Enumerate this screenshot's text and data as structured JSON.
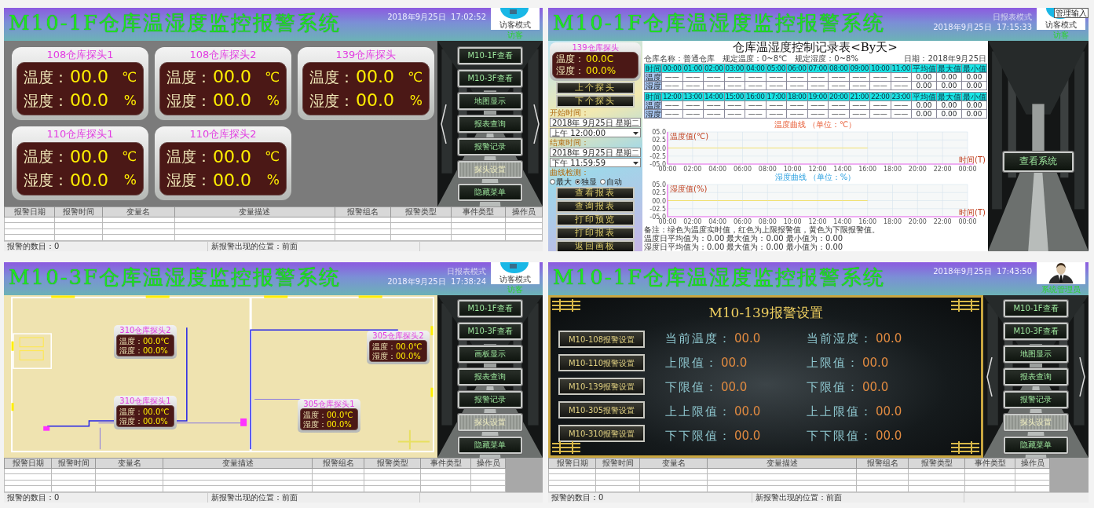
{
  "panels": [
    {
      "kind": "overview",
      "header": {
        "title": "M10-1F仓库温湿度监控报警系统",
        "datetime": "2018年9月25日  17:02:52",
        "user": {
          "kind": "logo",
          "badge": "访客模式",
          "role": "访客"
        }
      },
      "probes": [
        {
          "name": "108仓库探头1",
          "temp_label": "温度：",
          "temp": "00.0",
          "temp_unit": "℃",
          "hum_label": "湿度：",
          "hum": "00.0",
          "hum_unit": "%"
        },
        {
          "name": "108仓库探头2",
          "temp_label": "温度：",
          "temp": "00.0",
          "temp_unit": "℃",
          "hum_label": "湿度：",
          "hum": "00.0",
          "hum_unit": "%"
        },
        {
          "name": "139仓库探头",
          "temp_label": "温度：",
          "temp": "00.0",
          "temp_unit": "℃",
          "hum_label": "湿度：",
          "hum": "00.0",
          "hum_unit": "%"
        },
        {
          "name": "110仓库探头1",
          "temp_label": "温度：",
          "temp": "00.0",
          "temp_unit": "℃",
          "hum_label": "湿度：",
          "hum": "00.0",
          "hum_unit": "%"
        },
        {
          "name": "110仓库探头2",
          "temp_label": "温度：",
          "temp": "00.0",
          "temp_unit": "℃",
          "hum_label": "湿度：",
          "hum": "00.0",
          "hum_unit": "%"
        }
      ],
      "menu": [
        {
          "label": "M10-1F查看",
          "disabled": false
        },
        {
          "label": "M10-3F查看",
          "disabled": false
        },
        {
          "label": "地图显示",
          "disabled": false
        },
        {
          "label": "报表查询",
          "disabled": false
        },
        {
          "label": "报警记录",
          "disabled": false
        },
        {
          "label": "探头设置",
          "disabled": true
        },
        {
          "label": "隐藏菜单",
          "disabled": false
        }
      ],
      "nav_arrows": true,
      "alarm_table": {
        "columns": [
          "报警日期",
          "报警时间",
          "变量名",
          "变量描述",
          "报警组名",
          "报警类型",
          "事件类型",
          "操作员"
        ]
      },
      "status_bar": [
        "报警的数目：0",
        "新报警出现的位置：前面"
      ]
    },
    {
      "kind": "report",
      "header": {
        "title": "M10-1F仓库温湿度监控报警系统",
        "mode": "日报表模式",
        "datetime": "2018年9月25日  17:15:33",
        "user": {
          "kind": "logo",
          "badge": "访客模式",
          "tag": "管理输入",
          "role": "访客"
        }
      },
      "sidebar": {
        "probe": {
          "name": "139仓库探头",
          "temp_label": "温度：",
          "temp": "00.0",
          "temp_unit": "C",
          "hum_label": "湿度：",
          "hum": "00.0",
          "hum_unit": "%"
        },
        "nav_buttons": [
          "上个探头",
          "下个探头"
        ],
        "start": {
          "label": "开始时间：",
          "date": "2018年 9月25日 星期二",
          "time": "上午 12:00:00"
        },
        "end": {
          "label": "结束时间：",
          "date": "2018年 9月25日 星期二",
          "time": "下午 11:59:59"
        },
        "curve": {
          "label": "曲线检测：",
          "options": [
            {
              "label": "最大",
              "selected": false
            },
            {
              "label": "独显",
              "selected": true
            },
            {
              "label": "自动",
              "selected": false
            }
          ]
        },
        "actions": [
          "查看报表",
          "查询报表",
          "打印预览",
          "打印报表",
          "返回画板"
        ]
      },
      "report": {
        "title": "仓库温湿度控制记录表<By天>",
        "meta": [
          "仓库名称：普通仓库",
          "规定温度：0~8℃",
          "规定湿度：0~8%",
          "日期：2018年9月25日"
        ],
        "tables": [
          {
            "columns": [
              "时间",
              "00:00",
              "01:00",
              "02:00",
              "03:00",
              "04:00",
              "05:00",
              "06:00",
              "07:00",
              "08:00",
              "09:00",
              "10:00",
              "11:00",
              "平均值",
              "最大值",
              "最小值"
            ],
            "rows": [
              {
                "cells": [
                  "温度",
                  "——",
                  "——",
                  "——",
                  "——",
                  "——",
                  "——",
                  "——",
                  "——",
                  "——",
                  "——",
                  "——",
                  "——",
                  "0.00",
                  "0.00",
                  "0.00"
                ]
              },
              {
                "cells": [
                  "湿度",
                  "——",
                  "——",
                  "——",
                  "——",
                  "——",
                  "——",
                  "——",
                  "——",
                  "——",
                  "——",
                  "——",
                  "——",
                  "0.00",
                  "0.00",
                  "0.00"
                ]
              }
            ]
          },
          {
            "columns": [
              "时间",
              "12:00",
              "13:00",
              "14:00",
              "15:00",
              "16:00",
              "17:00",
              "18:00",
              "19:00",
              "20:00",
              "21:00",
              "22:00",
              "23:00",
              "平均值",
              "最大值",
              "最小值"
            ],
            "rows": [
              {
                "cells": [
                  "温度",
                  "——",
                  "——",
                  "——",
                  "——",
                  "——",
                  "——",
                  "——",
                  "——",
                  "——",
                  "——",
                  "——",
                  "——",
                  "0.00",
                  "0.00",
                  "0.00"
                ]
              },
              {
                "cells": [
                  "湿度",
                  "——",
                  "——",
                  "——",
                  "——",
                  "——",
                  "——",
                  "——",
                  "——",
                  "——",
                  "——",
                  "——",
                  "——",
                  "0.00",
                  "0.00",
                  "0.00"
                ]
              }
            ]
          }
        ],
        "charts": [
          {
            "chart_data": {
              "type": "line",
              "grid": true,
              "title": "温度曲线 （单位：℃）",
              "xlabel": "时间(T)",
              "ylabel": "温度值(℃)",
              "categories": [
                "00:00",
                "02:00",
                "04:00",
                "06:00",
                "08:00",
                "10:00",
                "12:00",
                "14:00",
                "16:00",
                "18:00",
                "20:00",
                "22:00",
                "00:00"
              ],
              "ylim": [
                -5,
                5
              ],
              "yticks": [
                {
                  "value": -5,
                  "label": "-05.0"
                },
                {
                  "value": -2.5,
                  "label": "-02.5"
                },
                {
                  "value": 0,
                  "label": "00.0"
                },
                {
                  "value": 2.5,
                  "label": "02.5"
                },
                {
                  "value": 5,
                  "label": "05.0"
                }
              ],
              "series": [
                {
                  "color": "#f0e070",
                  "values": [
                    0,
                    0,
                    0,
                    0,
                    0,
                    0,
                    0,
                    0,
                    0,
                    null,
                    null,
                    null,
                    null
                  ]
                }
              ]
            }
          },
          {
            "chart_data": {
              "type": "line",
              "grid": true,
              "title": "湿度曲线 （单位：%）",
              "xlabel": "时间(T)",
              "ylabel": "湿度值(%)",
              "categories": [
                "00:00",
                "02:00",
                "04:00",
                "06:00",
                "08:00",
                "10:00",
                "12:00",
                "14:00",
                "16:00",
                "18:00",
                "20:00",
                "22:00",
                "00:00"
              ],
              "ylim": [
                -5,
                5
              ],
              "yticks": [
                {
                  "value": -5,
                  "label": "-05.0"
                },
                {
                  "value": -2.5,
                  "label": "-02.5"
                },
                {
                  "value": 0,
                  "label": "00.0"
                },
                {
                  "value": 2.5,
                  "label": "02.5"
                },
                {
                  "value": 5,
                  "label": "05.0"
                }
              ],
              "series": [
                {
                  "color": "#f0e070",
                  "values": [
                    0,
                    0,
                    0,
                    0,
                    0,
                    0,
                    0,
                    0,
                    0,
                    null,
                    null,
                    null,
                    null
                  ]
                }
              ]
            }
          }
        ],
        "notes": [
          "备注：绿色为温度实时值，红色为上限报警值，黄色为下限报警值。",
          "温度日平均值为：0.00  最大值为：0.00  最小值为：0.00",
          "湿度日平均值为：0.00  最大值为：0.00  最小值为：0.00"
        ]
      },
      "side_button": "查看系统"
    },
    {
      "kind": "map",
      "header": {
        "title": "M10-3F仓库温湿度监控报警系统",
        "mode": "日报表模式",
        "datetime": "2018年9月25日  17:38:24",
        "user": {
          "kind": "logo",
          "badge": "访客模式",
          "role": "访客"
        }
      },
      "probes": [
        {
          "name": "310仓库探头2",
          "temp_label": "温度：",
          "temp": "00.0",
          "temp_unit": "℃",
          "hum_label": "湿度：",
          "hum": "00.0",
          "hum_unit": "%"
        },
        {
          "name": "310仓库探头1",
          "temp_label": "温度：",
          "temp": "00.0",
          "temp_unit": "℃",
          "hum_label": "湿度：",
          "hum": "00.0",
          "hum_unit": "%"
        },
        {
          "name": "305仓库探头2",
          "temp_label": "温度：",
          "temp": "00.0",
          "temp_unit": "℃",
          "hum_label": "湿度：",
          "hum": "00.0",
          "hum_unit": "%"
        },
        {
          "name": "305仓库探头1",
          "temp_label": "温度：",
          "temp": "00.0",
          "temp_unit": "℃",
          "hum_label": "湿度：",
          "hum": "00.0",
          "hum_unit": "%"
        }
      ],
      "menu": [
        {
          "label": "M10-1F查看",
          "disabled": false
        },
        {
          "label": "M10-3F查看",
          "disabled": false
        },
        {
          "label": "画板显示",
          "disabled": false
        },
        {
          "label": "报表查询",
          "disabled": false
        },
        {
          "label": "报警记录",
          "disabled": false
        },
        {
          "label": "探头设置",
          "disabled": true
        },
        {
          "label": "隐藏菜单",
          "disabled": false
        }
      ],
      "alarm_table": {
        "columns": [
          "报警日期",
          "报警时间",
          "变量名",
          "变量描述",
          "报警组名",
          "报警类型",
          "事件类型",
          "操作员"
        ]
      },
      "status_bar": [
        "报警的数目：0",
        "新报警出现的位置：前面"
      ]
    },
    {
      "kind": "alarm_settings",
      "header": {
        "title": "M10-1F仓库温湿度监控报警系统",
        "datetime": "2018年9月25日  17:43:50",
        "user": {
          "kind": "person",
          "role": "系统管理员"
        }
      },
      "settings": {
        "title": "M10-139报警设置",
        "probe_buttons": [
          "M10-108报警设置",
          "M10-110报警设置",
          "M10-139报警设置",
          "M10-305报警设置",
          "M10-310报警设置"
        ],
        "fields": [
          {
            "label": "当前温度：",
            "value": "00.0"
          },
          {
            "label": "当前湿度：",
            "value": "00.0"
          },
          {
            "label": "上限值：",
            "value": "00.0"
          },
          {
            "label": "上限值：",
            "value": "00.0"
          },
          {
            "label": "下限值：",
            "value": "00.0"
          },
          {
            "label": "下限值：",
            "value": "00.0"
          },
          {
            "label": "上上限值：",
            "value": "00.0"
          },
          {
            "label": "上上限值：",
            "value": "00.0"
          },
          {
            "label": "下下限值：",
            "value": "00.0"
          },
          {
            "label": "下下限值：",
            "value": "00.0"
          }
        ]
      },
      "menu": [
        {
          "label": "M10-1F查看",
          "disabled": false
        },
        {
          "label": "M10-3F查看",
          "disabled": false
        },
        {
          "label": "地图显示",
          "disabled": false
        },
        {
          "label": "报表查询",
          "disabled": false
        },
        {
          "label": "报警记录",
          "disabled": false
        },
        {
          "label": "探头设置",
          "disabled": true
        },
        {
          "label": "隐藏菜单",
          "disabled": false
        }
      ],
      "nav_arrows": true,
      "alarm_table": {
        "columns": [
          "报警日期",
          "报警时间",
          "变量名",
          "变量描述",
          "报警组名",
          "报警类型",
          "事件类型",
          "操作员"
        ]
      },
      "status_bar": [
        "报警的数目：0",
        "新报警出现的位置：前面"
      ]
    }
  ]
}
